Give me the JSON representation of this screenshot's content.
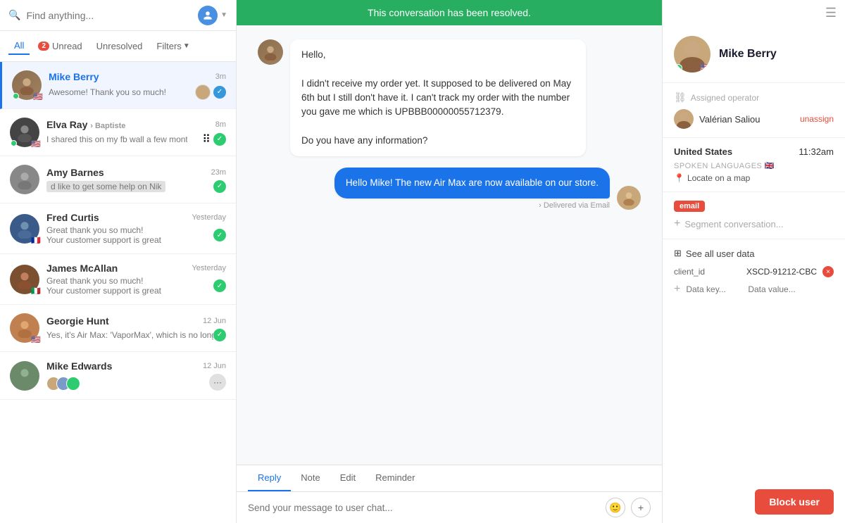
{
  "search": {
    "placeholder": "Find anything..."
  },
  "filterTabs": [
    {
      "id": "all",
      "label": "All",
      "active": true,
      "badge": null
    },
    {
      "id": "unread",
      "label": "Unread",
      "active": false,
      "badge": "2"
    },
    {
      "id": "unresolved",
      "label": "Unresolved",
      "active": false,
      "badge": null
    },
    {
      "id": "filters",
      "label": "Filters",
      "active": false,
      "badge": null,
      "hasArrow": true
    }
  ],
  "conversations": [
    {
      "id": "mike-berry",
      "name": "Mike Berry",
      "nameColor": "blue",
      "time": "3m",
      "preview": "Awesome! Thank you so much!",
      "online": true,
      "flag": "🇺🇸",
      "avatarClass": "av-mike",
      "active": true,
      "checkType": "blue",
      "hasSubAvatars": false
    },
    {
      "id": "elva-ray",
      "name": "Elva Ray",
      "nameColor": "gray",
      "subName": "Baptiste",
      "time": "8m",
      "preview": "I shared this on my fb wall a few months backshare, and I got a...",
      "online": true,
      "flag": "🇺🇸",
      "avatarClass": "av-elva",
      "active": false,
      "checkType": "green",
      "hasSubAvatars": false
    },
    {
      "id": "amy-barnes",
      "name": "Amy Barnes",
      "nameColor": "gray",
      "time": "23m",
      "preview": "d like to get some help on Nik",
      "online": false,
      "flag": "",
      "avatarClass": "av-amy",
      "active": false,
      "checkType": "green",
      "hasSubAvatars": false
    },
    {
      "id": "fred-curtis",
      "name": "Fred Curtis",
      "nameColor": "gray",
      "time": "Yesterday",
      "preview": "Great thank you so much! Your customer support is great",
      "online": false,
      "flag": "🇫🇷",
      "avatarClass": "av-fred",
      "active": false,
      "checkType": "green",
      "hasSubAvatars": false
    },
    {
      "id": "james-mcallan",
      "name": "James McAllan",
      "nameColor": "gray",
      "time": "Yesterday",
      "preview": "Great thank you so much! Your customer support is great",
      "online": false,
      "flag": "🇮🇹",
      "avatarClass": "av-james",
      "active": false,
      "checkType": "green",
      "hasSubAvatars": false
    },
    {
      "id": "georgie-hunt",
      "name": "Georgie Hunt",
      "nameColor": "gray",
      "time": "12 Jun",
      "preview": "Yes, it's Air Max: 'VaporMax', which is no longer offered. So...",
      "online": false,
      "flag": "🇺🇸",
      "avatarClass": "av-georgie",
      "active": false,
      "checkType": "green",
      "hasSubAvatars": false
    },
    {
      "id": "mike-edwards",
      "name": "Mike Edwards",
      "nameColor": "gray",
      "time": "12 Jun",
      "preview": "",
      "online": false,
      "flag": "",
      "avatarClass": "av-edwards",
      "active": false,
      "checkType": null,
      "hasSubAvatars": true
    }
  ],
  "resolvedBanner": "This conversation has been resolved.",
  "messages": [
    {
      "type": "incoming",
      "text": "Hello,\n\nI didn't receive my order yet. It supposed to be delivered on May 6th but I still don't have it. I can't track my order with the number you gave me which is UPBBB00000055712379.\n\nDo you have any information?",
      "avatarClass": "av-mike"
    },
    {
      "type": "outgoing",
      "text": "Hello Mike! The new Air Max are now available on our store.",
      "avatarClass": "av-operator",
      "deliveredLabel": "Delivered via Email"
    }
  ],
  "replyTabs": [
    {
      "id": "reply",
      "label": "Reply",
      "active": true
    },
    {
      "id": "note",
      "label": "Note",
      "active": false
    },
    {
      "id": "edit",
      "label": "Edit",
      "active": false
    },
    {
      "id": "reminder",
      "label": "Reminder",
      "active": false
    }
  ],
  "replyPlaceholder": "Send your message to user chat...",
  "rightPanel": {
    "name": "Mike Berry",
    "assignedLabel": "Assigned operator",
    "assignedName": "Valérian Saliou",
    "unassignLabel": "unassign",
    "country": "United States",
    "time": "11:32am",
    "spokenLanguagesLabel": "SPOKEN LANGUAGES",
    "locateLabel": "Locate on a map",
    "tags": [
      "email"
    ],
    "segmentPlaceholder": "Segment conversation...",
    "seeAllLabel": "See all user data",
    "clientId": "client_id",
    "clientIdValue": "XSCD-91212-CBC",
    "dataKeyPlaceholder": "Data key...",
    "dataValuePlaceholder": "Data value...",
    "blockUserLabel": "Block user"
  }
}
